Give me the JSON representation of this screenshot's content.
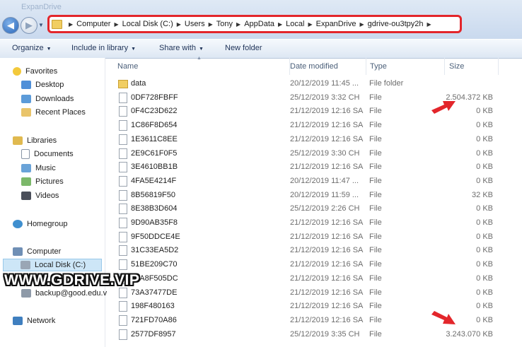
{
  "window": {
    "title_faded": "ExpanDrive"
  },
  "address": {
    "crumbs": [
      "Computer",
      "Local Disk (C:)",
      "Users",
      "Tony",
      "AppData",
      "Local",
      "ExpanDrive",
      "gdrive-ou3tpy2h"
    ]
  },
  "toolbar": {
    "organize": "Organize",
    "include_library": "Include in library",
    "share_with": "Share with",
    "new_folder": "New folder"
  },
  "nav": {
    "favorites": "Favorites",
    "desktop": "Desktop",
    "downloads": "Downloads",
    "recent": "Recent Places",
    "libraries": "Libraries",
    "documents": "Documents",
    "music": "Music",
    "pictures": "Pictures",
    "videos": "Videos",
    "homegroup": "Homegroup",
    "computer": "Computer",
    "local_disk": "Local Disk (C:)",
    "backup": "backup@good.edu.v",
    "network": "Network"
  },
  "columns": {
    "name": "Name",
    "date": "Date modified",
    "type": "Type",
    "size": "Size"
  },
  "files": [
    {
      "name": "data",
      "date": "20/12/2019 11:45 ...",
      "type": "File folder",
      "size": "",
      "icon": "folder-icon"
    },
    {
      "name": "0DF728FBFF",
      "date": "25/12/2019 3:32 CH",
      "type": "File",
      "size": "2.504.372 KB",
      "icon": "file-icon"
    },
    {
      "name": "0F4C23D622",
      "date": "21/12/2019 12:16 SA",
      "type": "File",
      "size": "0 KB",
      "icon": "file-icon"
    },
    {
      "name": "1C86F8D654",
      "date": "21/12/2019 12:16 SA",
      "type": "File",
      "size": "0 KB",
      "icon": "file-icon"
    },
    {
      "name": "1E3611C8EE",
      "date": "21/12/2019 12:16 SA",
      "type": "File",
      "size": "0 KB",
      "icon": "file-icon"
    },
    {
      "name": "2E9C61F0F5",
      "date": "25/12/2019 3:30 CH",
      "type": "File",
      "size": "0 KB",
      "icon": "file-icon"
    },
    {
      "name": "3E4610BB1B",
      "date": "21/12/2019 12:16 SA",
      "type": "File",
      "size": "0 KB",
      "icon": "file-icon"
    },
    {
      "name": "4FA5E4214F",
      "date": "20/12/2019 11:47 ...",
      "type": "File",
      "size": "0 KB",
      "icon": "file-icon"
    },
    {
      "name": "8B56819F50",
      "date": "20/12/2019 11:59 ...",
      "type": "File",
      "size": "32 KB",
      "icon": "file-icon"
    },
    {
      "name": "8E38B3D604",
      "date": "25/12/2019 2:26 CH",
      "type": "File",
      "size": "0 KB",
      "icon": "file-icon"
    },
    {
      "name": "9D90AB35F8",
      "date": "21/12/2019 12:16 SA",
      "type": "File",
      "size": "0 KB",
      "icon": "file-icon"
    },
    {
      "name": "9F50DDCE4E",
      "date": "21/12/2019 12:16 SA",
      "type": "File",
      "size": "0 KB",
      "icon": "file-icon"
    },
    {
      "name": "31C33EA5D2",
      "date": "21/12/2019 12:16 SA",
      "type": "File",
      "size": "0 KB",
      "icon": "file-icon"
    },
    {
      "name": "51BE209C70",
      "date": "21/12/2019 12:16 SA",
      "type": "File",
      "size": "0 KB",
      "icon": "file-icon"
    },
    {
      "name": "69A8F505DC",
      "date": "21/12/2019 12:16 SA",
      "type": "File",
      "size": "0 KB",
      "icon": "file-icon"
    },
    {
      "name": "73A37477DE",
      "date": "21/12/2019 12:16 SA",
      "type": "File",
      "size": "0 KB",
      "icon": "file-icon"
    },
    {
      "name": "198F480163",
      "date": "21/12/2019 12:16 SA",
      "type": "File",
      "size": "0 KB",
      "icon": "file-icon"
    },
    {
      "name": "721FD70A86",
      "date": "21/12/2019 12:16 SA",
      "type": "File",
      "size": "0 KB",
      "icon": "file-icon"
    },
    {
      "name": "2577DF8957",
      "date": "25/12/2019 3:35 CH",
      "type": "File",
      "size": "3.243.070 KB",
      "icon": "file-icon"
    }
  ],
  "watermark": "WWW.GDRIVE.VIP",
  "colors": {
    "highlight_red": "#e3262b",
    "selection": "#cde6f7"
  }
}
